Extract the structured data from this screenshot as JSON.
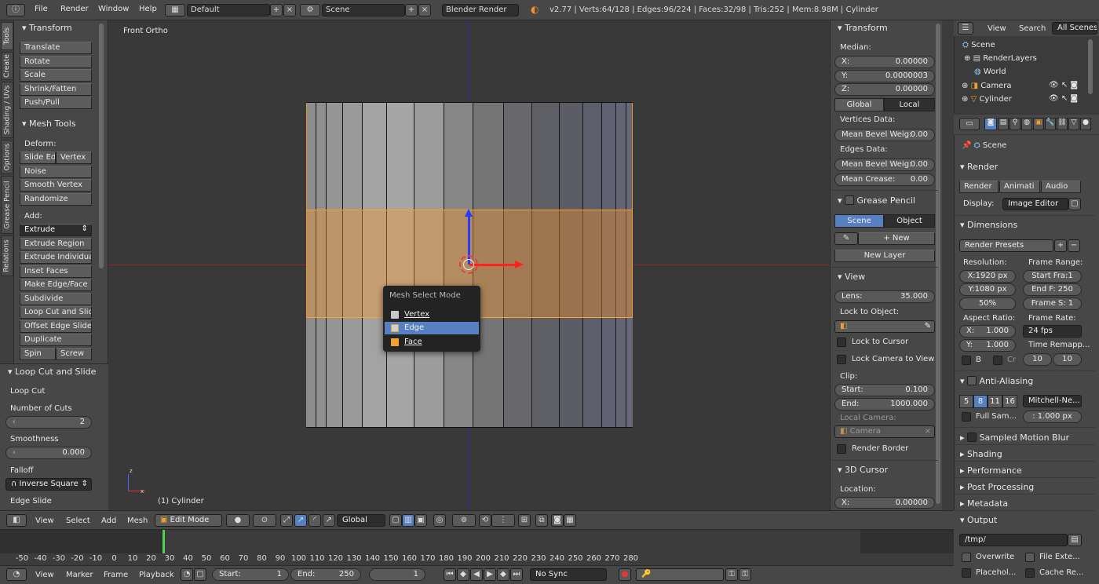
{
  "topbar": {
    "menus": [
      "File",
      "Render",
      "Window",
      "Help"
    ],
    "screen_layout": "Default",
    "scene": "Scene",
    "render_engine": "Blender Render",
    "stats": "v2.77 | Verts:64/128 | Edges:96/224 | Faces:32/98 | Tris:252 | Mem:8.98M | Cylinder"
  },
  "tool_tabs": [
    "Tools",
    "Create",
    "Shading / UVs",
    "Options",
    "Grease Pencil",
    "Relations"
  ],
  "toolshelf": {
    "transform_header": "Transform",
    "transform_buttons": [
      "Translate",
      "Rotate",
      "Scale",
      "Shrink/Fatten",
      "Push/Pull"
    ],
    "mesh_tools_header": "Mesh Tools",
    "deform_label": "Deform:",
    "slide_edge": "Slide Ed",
    "vertex": "Vertex",
    "deform_buttons": [
      "Noise",
      "Smooth Vertex",
      "Randomize"
    ],
    "add_label": "Add:",
    "extrude": "Extrude",
    "add_buttons": [
      "Extrude Region",
      "Extrude Individual",
      "Inset Faces",
      "Make Edge/Face",
      "Subdivide",
      "Loop Cut and Slide",
      "Offset Edge Slide",
      "Duplicate"
    ],
    "spin": "Spin",
    "screw": "Screw"
  },
  "operator": {
    "header": "Loop Cut and Slide",
    "loop_cut": "Loop Cut",
    "cuts_label": "Number of Cuts",
    "cuts_value": "2",
    "smoothness_label": "Smoothness",
    "smoothness_value": "0.000",
    "falloff_label": "Falloff",
    "falloff_value": "Inverse Square",
    "edge_slide": "Edge Slide"
  },
  "viewport": {
    "view_name": "Front Ortho",
    "object_label": "(1) Cylinder",
    "axis_z": "z",
    "axis_x": "x"
  },
  "popup": {
    "title": "Mesh Select Mode",
    "items": [
      "Vertex",
      "Edge",
      "Face"
    ],
    "selected": "Edge"
  },
  "npanel": {
    "transform_header": "Transform",
    "median_label": "Median:",
    "x": {
      "label": "X:",
      "value": "0.00000"
    },
    "y": {
      "label": "Y:",
      "value": "0.0000003"
    },
    "z": {
      "label": "Z:",
      "value": "0.00000"
    },
    "global": "Global",
    "local": "Local",
    "vertices_data": "Vertices Data:",
    "mean_bevel_v": {
      "label": "Mean Bevel Weig:",
      "value": "0.00"
    },
    "edges_data": "Edges Data:",
    "mean_bevel_e": {
      "label": "Mean Bevel Weig:",
      "value": "0.00"
    },
    "mean_crease": {
      "label": "Mean Crease:",
      "value": "0.00"
    },
    "grease_pencil_header": "Grease Pencil",
    "scene_tab": "Scene",
    "object_tab": "Object",
    "new": "New",
    "new_layer": "New Layer",
    "view_header": "View",
    "lens": {
      "label": "Lens:",
      "value": "35.000"
    },
    "lock_to_object": "Lock to Object:",
    "lock_to_cursor": "Lock to Cursor",
    "lock_camera": "Lock Camera to View",
    "clip_label": "Clip:",
    "clip_start": {
      "label": "Start:",
      "value": "0.100"
    },
    "clip_end": {
      "label": "End:",
      "value": "1000.000"
    },
    "local_camera": "Local Camera:",
    "camera": "Camera",
    "render_border": "Render Border",
    "cursor_header": "3D Cursor",
    "location_label": "Location:",
    "cursor_x": {
      "label": "X:",
      "value": "0.00000"
    }
  },
  "outliner": {
    "view": "View",
    "search": "Search",
    "all_scenes": "All Scenes",
    "items": [
      "Scene",
      "RenderLayers",
      "World",
      "Camera",
      "Cylinder"
    ]
  },
  "properties": {
    "scene_path": "Scene",
    "render_header": "Render",
    "render_btn": "Render",
    "animation_btn": "Animati",
    "audio_btn": "Audio",
    "display_label": "Display:",
    "display_value": "Image Editor",
    "dimensions_header": "Dimensions",
    "render_presets": "Render Presets",
    "resolution_label": "Resolution:",
    "frame_range_label": "Frame Range:",
    "res_x": "X:1920 px",
    "res_y": "Y:1080 px",
    "res_pct": "50%",
    "start_frame": "Start Fra:1",
    "end_frame": "End F: 250",
    "frame_step": "Frame S: 1",
    "aspect_label": "Aspect Ratio:",
    "frame_rate_label": "Frame Rate:",
    "aspect_x": {
      "label": "X:",
      "value": "1.000"
    },
    "aspect_y": {
      "label": "Y:",
      "value": "1.000"
    },
    "fps": "24 fps",
    "time_remap": "Time Remapp...",
    "border_b": "B",
    "border_cr": "Cr",
    "remap_old": "10",
    "remap_new": "10",
    "aa_header": "Anti-Aliasing",
    "aa_samples": [
      "5",
      "8",
      "11",
      "16"
    ],
    "aa_filter": "Mitchell-Ne...",
    "full_sample": "Full Sam...",
    "filter_size": ": 1.000 px",
    "sampled_motion_blur": "Sampled Motion Blur",
    "shading": "Shading",
    "performance": "Performance",
    "post_processing": "Post Processing",
    "metadata": "Metadata",
    "output_header": "Output",
    "output_path": "/tmp/",
    "overwrite": "Overwrite",
    "file_ext": "File Exte...",
    "placeholders": "Placehol...",
    "cache_result": "Cache Re..."
  },
  "header3d": {
    "menus": [
      "View",
      "Select",
      "Add",
      "Mesh"
    ],
    "mode": "Edit Mode",
    "orientation": "Global"
  },
  "timeline": {
    "ticks": [
      "-50",
      "-40",
      "-30",
      "-20",
      "-10",
      "0",
      "10",
      "20",
      "30",
      "40",
      "50",
      "60",
      "70",
      "80",
      "90",
      "100",
      "110",
      "120",
      "130",
      "140",
      "150",
      "160",
      "170",
      "180",
      "190",
      "200",
      "210",
      "220",
      "230",
      "240",
      "250",
      "260",
      "270",
      "280"
    ],
    "current_frame_value": 0
  },
  "timeline_header": {
    "menus": [
      "View",
      "Marker",
      "Frame",
      "Playback"
    ],
    "start": {
      "label": "Start:",
      "value": "1"
    },
    "end": {
      "label": "End:",
      "value": "250"
    },
    "current": "1",
    "sync": "No Sync"
  },
  "colors": {
    "accent": "#5680c2",
    "selection": "#ffa030",
    "panel": "#474747",
    "viewport": "#393939"
  }
}
